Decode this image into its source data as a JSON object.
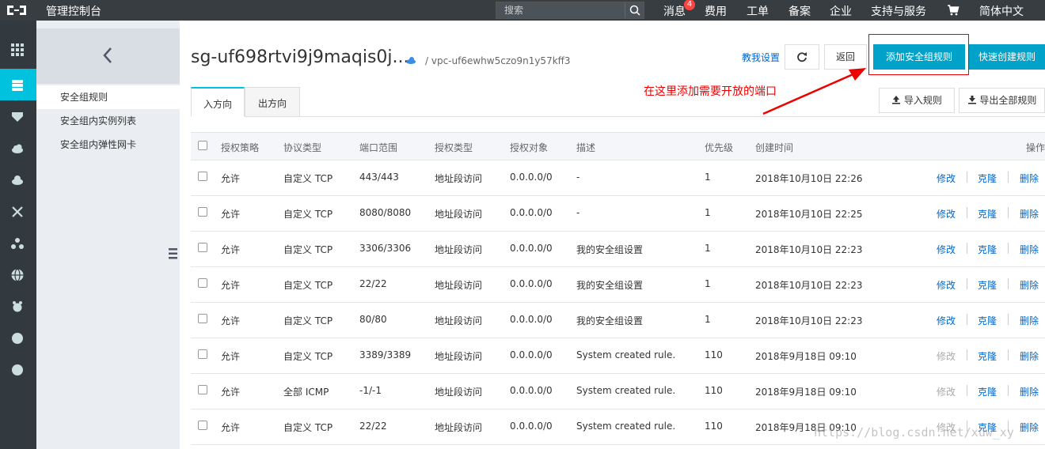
{
  "topbar": {
    "console_title": "管理控制台",
    "search_placeholder": "搜索",
    "nav": {
      "messages": "消息",
      "messages_badge": "4",
      "billing": "费用",
      "tickets": "工单",
      "filing": "备案",
      "enterprise": "企业",
      "support": "支持与服务",
      "language": "简体中文"
    }
  },
  "subsidebar": {
    "items": [
      "安全组规则",
      "安全组内实例列表",
      "安全组内弹性网卡"
    ]
  },
  "header": {
    "title": "sg-uf698rtvi9j9maqis0j...",
    "vpc_link": "/ vpc-uf6ewhw5czo9n1y57kff3",
    "help_link": "教我设置",
    "back_button": "返回",
    "add_rule_button": "添加安全组规则",
    "quick_create_button": "快速创建规则",
    "import_button": "导入规则",
    "export_button": "导出全部规则"
  },
  "annotation": "在这里添加需要开放的端口",
  "tabs": [
    "入方向",
    "出方向"
  ],
  "table": {
    "headers": {
      "policy": "授权策略",
      "protocol": "协议类型",
      "port": "端口范围",
      "auth_type": "授权类型",
      "auth_object": "授权对象",
      "desc": "描述",
      "priority": "优先级",
      "created": "创建时间",
      "ops": "操作"
    },
    "rows": [
      {
        "policy": "允许",
        "protocol": "自定义 TCP",
        "port": "443/443",
        "auth_type": "地址段访问",
        "auth_object": "0.0.0.0/0",
        "desc": "-",
        "priority": "1",
        "created": "2018年10月10日 22:26",
        "edit": "修改",
        "edit_disabled": false,
        "clone": "克隆",
        "delete": "删除"
      },
      {
        "policy": "允许",
        "protocol": "自定义 TCP",
        "port": "8080/8080",
        "auth_type": "地址段访问",
        "auth_object": "0.0.0.0/0",
        "desc": "-",
        "priority": "1",
        "created": "2018年10月10日 22:25",
        "edit": "修改",
        "edit_disabled": false,
        "clone": "克隆",
        "delete": "删除"
      },
      {
        "policy": "允许",
        "protocol": "自定义 TCP",
        "port": "3306/3306",
        "auth_type": "地址段访问",
        "auth_object": "0.0.0.0/0",
        "desc": "我的安全组设置",
        "priority": "1",
        "created": "2018年10月10日 22:23",
        "edit": "修改",
        "edit_disabled": false,
        "clone": "克隆",
        "delete": "删除"
      },
      {
        "policy": "允许",
        "protocol": "自定义 TCP",
        "port": "22/22",
        "auth_type": "地址段访问",
        "auth_object": "0.0.0.0/0",
        "desc": "我的安全组设置",
        "priority": "1",
        "created": "2018年10月10日 22:23",
        "edit": "修改",
        "edit_disabled": false,
        "clone": "克隆",
        "delete": "删除"
      },
      {
        "policy": "允许",
        "protocol": "自定义 TCP",
        "port": "80/80",
        "auth_type": "地址段访问",
        "auth_object": "0.0.0.0/0",
        "desc": "我的安全组设置",
        "priority": "1",
        "created": "2018年10月10日 22:23",
        "edit": "修改",
        "edit_disabled": false,
        "clone": "克隆",
        "delete": "删除"
      },
      {
        "policy": "允许",
        "protocol": "自定义 TCP",
        "port": "3389/3389",
        "auth_type": "地址段访问",
        "auth_object": "0.0.0.0/0",
        "desc": "System created rule.",
        "priority": "110",
        "created": "2018年9月18日 09:10",
        "edit": "修改",
        "edit_disabled": true,
        "clone": "克隆",
        "delete": "删除"
      },
      {
        "policy": "允许",
        "protocol": "全部 ICMP",
        "port": "-1/-1",
        "auth_type": "地址段访问",
        "auth_object": "0.0.0.0/0",
        "desc": "System created rule.",
        "priority": "110",
        "created": "2018年9月18日 09:10",
        "edit": "修改",
        "edit_disabled": true,
        "clone": "克隆",
        "delete": "删除"
      },
      {
        "policy": "允许",
        "protocol": "自定义 TCP",
        "port": "22/22",
        "auth_type": "地址段访问",
        "auth_object": "0.0.0.0/0",
        "desc": "System created rule.",
        "priority": "110",
        "created": "2018年9月18日 09:10",
        "edit": "修改",
        "edit_disabled": true,
        "clone": "克隆",
        "delete": "删除"
      }
    ]
  },
  "watermark": "https://blog.csdn.net/xuw_xy",
  "colors": {
    "topbar": "#373d41",
    "iconbar": "#333a3f",
    "accent": "#00c1de",
    "primary_button": "#00a2ca",
    "link": "#0066cc",
    "annotation": "#ee0000"
  },
  "icons": [
    "grid-icon",
    "server-icon",
    "shield-icon",
    "cloud-icon",
    "upload-cloud-icon",
    "network-icon",
    "cluster-icon",
    "globe-icon",
    "gear-icon",
    "circle-icon",
    "circle-icon",
    "refresh-icon",
    "upload-icon",
    "download-icon",
    "chevron-left-icon",
    "search-icon",
    "cart-icon"
  ]
}
